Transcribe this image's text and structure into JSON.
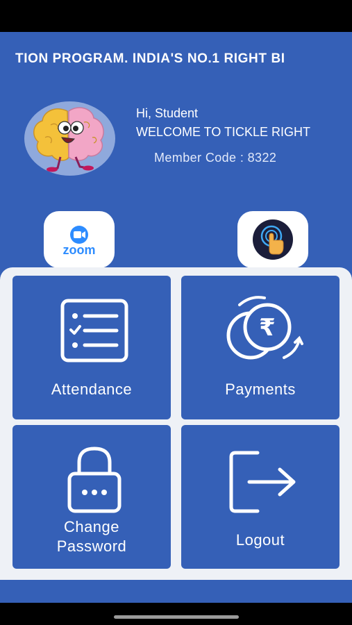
{
  "marquee": "TION PROGRAM. INDIA'S NO.1 RIGHT BI",
  "profile": {
    "greeting": "Hi, Student",
    "welcome": "WELCOME TO TICKLE RIGHT",
    "member_code": "Member Code : 8322"
  },
  "quick_links": {
    "zoom_label": "zoom",
    "zoom_icon": "zoom-video-camera-icon",
    "touch_icon": "hand-tap-icon"
  },
  "menu": {
    "attendance": "Attendance",
    "payments": "Payments",
    "change_password_line1": "Change",
    "change_password_line2": "Password",
    "logout": "Logout"
  },
  "colors": {
    "primary": "#3560B7",
    "panel": "#EEF1F6",
    "zoom_blue": "#2D8CFF"
  }
}
